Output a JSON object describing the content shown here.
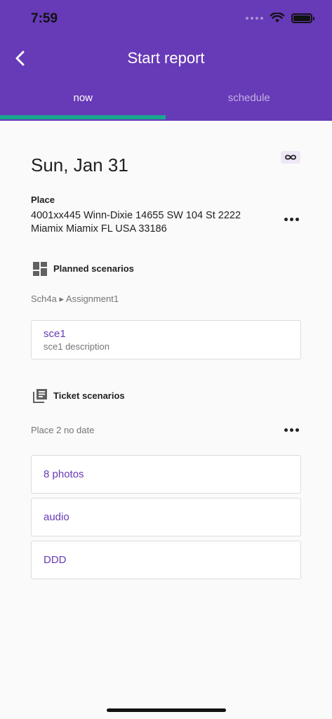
{
  "status_bar": {
    "time": "7:59"
  },
  "header": {
    "title": "Start report"
  },
  "tabs": [
    {
      "label": "now",
      "active": true
    },
    {
      "label": "schedule",
      "active": false
    }
  ],
  "report": {
    "date": "Sun, Jan 31",
    "place_label": "Place",
    "place_address": "4001xx445 Winn-Dixie 14655 SW 104 St 2222 Miamix Miamix FL USA 33186"
  },
  "planned": {
    "title": "Planned scenarios",
    "breadcrumb": "Sch4a ▸ Assignment1",
    "cards": [
      {
        "title": "sce1",
        "description": "sce1 description"
      }
    ]
  },
  "ticket": {
    "title": "Ticket scenarios",
    "subtitle": "Place 2 no date",
    "cards": [
      {
        "title": "8 photos"
      },
      {
        "title": "audio"
      },
      {
        "title": "DDD"
      }
    ]
  },
  "colors": {
    "primary": "#673ab7",
    "tab_indicator": "#1aa591",
    "background": "#fafafa"
  },
  "icons": [
    "back-arrow-icon",
    "wifi-icon",
    "battery-icon",
    "infinity-icon",
    "more-icon",
    "dashboard-icon",
    "library-books-icon"
  ]
}
